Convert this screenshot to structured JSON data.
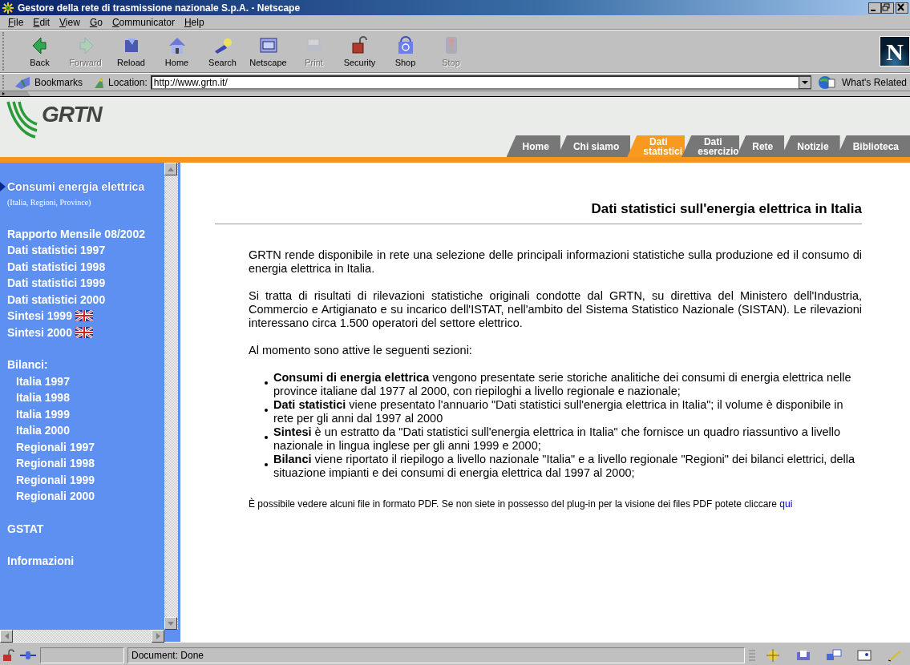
{
  "window": {
    "title": "Gestore della rete di trasmissione nazionale S.p.A. - Netscape"
  },
  "menu": [
    "File",
    "Edit",
    "View",
    "Go",
    "Communicator",
    "Help"
  ],
  "toolbar": [
    {
      "label": "Back",
      "disabled": false
    },
    {
      "label": "Forward",
      "disabled": true
    },
    {
      "label": "Reload",
      "disabled": false
    },
    {
      "label": "Home",
      "disabled": false
    },
    {
      "label": "Search",
      "disabled": false
    },
    {
      "label": "Netscape",
      "disabled": false
    },
    {
      "label": "Print",
      "disabled": true
    },
    {
      "label": "Security",
      "disabled": false
    },
    {
      "label": "Shop",
      "disabled": false
    },
    {
      "label": "Stop",
      "disabled": true
    }
  ],
  "brand_logo": "N",
  "location_bar": {
    "bookmarks": "Bookmarks",
    "label": "Location:",
    "value": "http://www.grtn.it/",
    "related": "What's Related"
  },
  "site": {
    "logo": "GRTN",
    "tabs": [
      {
        "label": "Home",
        "selected": false
      },
      {
        "label": "Chi siamo",
        "selected": false
      },
      {
        "label": "Dati statistici",
        "selected": true
      },
      {
        "label": "Dati esercizio",
        "selected": false
      },
      {
        "label": "Rete",
        "selected": false
      },
      {
        "label": "Notizie",
        "selected": false
      },
      {
        "label": "Biblioteca",
        "selected": false
      }
    ]
  },
  "sidebar": {
    "groups": [
      {
        "items": [
          {
            "label": "Consumi energia elettrica",
            "kind": "link",
            "selected": true
          },
          {
            "label": "(Italia, Regioni, Province)",
            "kind": "note",
            "selected": false
          }
        ]
      },
      {
        "items": [
          {
            "label": "Rapporto Mensile 08/2002",
            "kind": "link",
            "selected": false
          },
          {
            "label": "Dati statistici 1997",
            "kind": "link",
            "selected": false
          },
          {
            "label": "Dati statistici 1998",
            "kind": "link",
            "selected": false
          },
          {
            "label": "Dati statistici 1999",
            "kind": "link",
            "selected": false
          },
          {
            "label": "Dati statistici 2000",
            "kind": "link",
            "selected": false
          },
          {
            "label": "Sintesi 1999",
            "kind": "flagged",
            "selected": false
          },
          {
            "label": "Sintesi 2000",
            "kind": "flagged",
            "selected": false
          }
        ]
      },
      {
        "items": [
          {
            "label": "Bilanci:",
            "kind": "link",
            "selected": false
          },
          {
            "label": "Italia 1997",
            "kind": "sub",
            "selected": false
          },
          {
            "label": "Italia 1998",
            "kind": "sub",
            "selected": false
          },
          {
            "label": "Italia 1999",
            "kind": "sub",
            "selected": false
          },
          {
            "label": "Italia 2000",
            "kind": "sub",
            "selected": false
          },
          {
            "label": "Regionali 1997",
            "kind": "sub",
            "selected": false
          },
          {
            "label": "Regionali 1998",
            "kind": "sub",
            "selected": false
          },
          {
            "label": "Regionali 1999",
            "kind": "sub",
            "selected": false
          },
          {
            "label": "Regionali 2000",
            "kind": "sub",
            "selected": false
          }
        ]
      },
      {
        "items": [
          {
            "label": "GSTAT",
            "kind": "link",
            "selected": false
          }
        ]
      },
      {
        "items": [
          {
            "label": "Informazioni",
            "kind": "link",
            "selected": false
          }
        ]
      }
    ]
  },
  "content": {
    "title": "Dati statistici sull'energia elettrica in Italia",
    "paragraphs": [
      "GRTN rende disponibile in rete una selezione delle principali informazioni statistiche sulla produzione ed il consumo di energia elettrica in Italia.",
      "Si tratta di risultati di rilevazioni statistiche originali condotte dal GRTN, su direttiva del Ministero dell'Industria, Commercio e Artigianato e su incarico dell'ISTAT, nell'ambito del Sistema Statistico Nazionale (SISTAN). Le rilevazioni interessano circa 1.500 operatori del settore elettrico.",
      "Al momento sono attive le seguenti sezioni:"
    ],
    "bullets": [
      "**Consumi di energia elettrica** vengono presentate serie storiche analitiche dei consumi di energia elettrica nelle province italiane dal 1977 al 2000, con riepiloghi a livello regionale e nazionale;",
      "**Dati statistici** viene presentato l'annuario \"Dati statistici sull'energia elettrica in Italia\"; il volume è disponibile in rete per gli anni dal 1997 al 2000",
      "**Sintesi** è un estratto da \"Dati statistici sull'energia elettrica in Italia\" che fornisce un quadro riassuntivo a livello nazionale in lingua inglese per gli anni 1999 e 2000;",
      "**Bilanci** viene riportato il riepilogo a livello nazionale \"Italia\" e a livello regionale \"Regioni\" dei bilanci elettrici, della situazione impianti e dei consumi di energia elettrica dal 1997 al 2000;"
    ],
    "note": {
      "text": "È possibile vedere alcuni file in formato PDF. Se non siete in possesso del plug-in per la visione dei files PDF potete cliccare",
      "link": "qui"
    }
  },
  "status_bar": {
    "text": "Document: Done"
  }
}
